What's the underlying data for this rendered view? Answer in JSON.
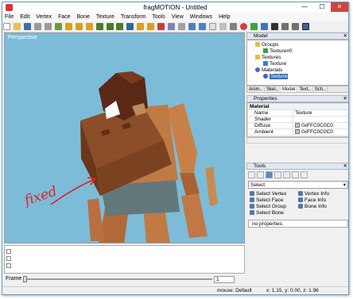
{
  "window": {
    "title": "fragMOTION - Untitled",
    "minimize": "—",
    "maximize": "☐",
    "close": "✕"
  },
  "menu": [
    "File",
    "Edit",
    "Vertex",
    "Face",
    "Bone",
    "Texture",
    "Transform",
    "Tools",
    "View",
    "Windows",
    "Help"
  ],
  "viewport": {
    "label": "Perspective",
    "annotation": "fixed"
  },
  "model_panel": {
    "title": "Model",
    "tree": [
      {
        "label": "Groups",
        "indent": 1
      },
      {
        "label": "Texture#0",
        "indent": 2
      },
      {
        "label": "Textures",
        "indent": 1
      },
      {
        "label": "Texture",
        "indent": 2
      },
      {
        "label": "Materials",
        "indent": 1
      },
      {
        "label": "Texture",
        "indent": 2
      }
    ],
    "tabs": [
      "Anim..",
      "Skel..",
      "Model",
      "Text..",
      "Sch.."
    ]
  },
  "properties_panel": {
    "title": "Properties",
    "header": "Material",
    "rows": [
      {
        "key": "Name",
        "value": "Texture"
      },
      {
        "key": "Shader",
        "value": ""
      },
      {
        "key": "Diffuse",
        "value": "0xFFC0C0C0"
      },
      {
        "key": "Ambient",
        "value": "0xFFC0C0C0"
      }
    ]
  },
  "tools_panel": {
    "title": "Tools",
    "select_value": "Select",
    "items": [
      "Select Vertex",
      "Vertex Info",
      "Select Face",
      "Face Info",
      "Select Group",
      "Bone Info",
      "Select Bone",
      ""
    ],
    "no_props": "no properties"
  },
  "frame": {
    "label": "Frame",
    "value1": "1",
    "value2": "0",
    "value3": "0"
  },
  "status": {
    "mode": "mouse: Default",
    "coords": "x: 1.15, y: 0.00, z: 1.96"
  },
  "colors": {
    "sky": "#7cbcd8",
    "skin": "#c08040",
    "shirt": "#667a78",
    "hair": "#5a2814",
    "arrow": "#e02020"
  }
}
